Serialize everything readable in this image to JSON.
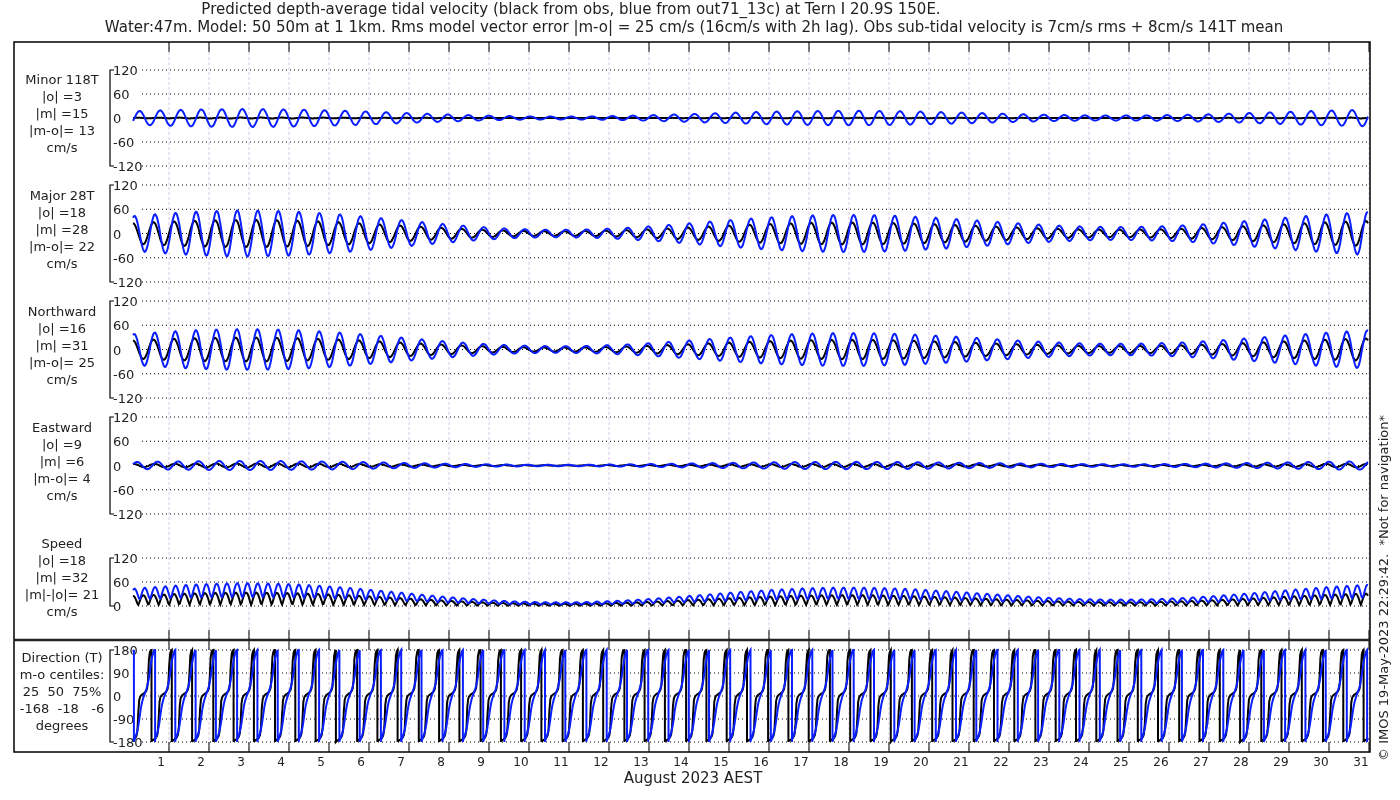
{
  "title_lines": [
    "Predicted depth-average tidal velocity (black from obs, blue from out71_13c) at Tern I 20.9S 150E.",
    "Water:47m. Model: 50 50m at 1 1km. Rms model vector error |m-o| = 25 cm/s (16cm/s with 2h lag). Obs sub-tidal velocity is 7cm/s rms + 8cm/s 141T mean"
  ],
  "panels": [
    {
      "kind": "component",
      "label_lines": [
        "Minor 118T",
        "|o| =3",
        "|m| =15",
        "|m-o|= 13",
        "cm/s"
      ],
      "yticks": [
        "120",
        "60",
        "0",
        "-60",
        "-120"
      ]
    },
    {
      "kind": "component",
      "label_lines": [
        "Major 28T",
        "|o| =18",
        "|m| =28",
        "|m-o|= 22",
        "cm/s"
      ],
      "yticks": [
        "120",
        "60",
        "0",
        "-60",
        "-120"
      ]
    },
    {
      "kind": "component",
      "label_lines": [
        "Northward",
        "|o| =16",
        "|m| =31",
        "|m-o|= 25",
        "cm/s"
      ],
      "yticks": [
        "120",
        "60",
        "0",
        "-60",
        "-120"
      ]
    },
    {
      "kind": "component",
      "label_lines": [
        "Eastward",
        "|o| =9",
        "|m| =6",
        "|m-o|= 4",
        "cm/s"
      ],
      "yticks": [
        "120",
        "60",
        "0",
        "-60",
        "-120"
      ]
    },
    {
      "kind": "speed",
      "label_lines": [
        "Speed",
        "|o| =18",
        "|m| =32",
        "|m|-|o|= 21",
        "cm/s"
      ],
      "yticks": [
        "120",
        "60",
        "0"
      ]
    },
    {
      "kind": "direction",
      "label_lines": [
        "Direction (T)",
        "m-o centiles:",
        "25  50  75%",
        "-168  -18   -6",
        "degrees"
      ],
      "yticks": [
        "180",
        "90",
        "0",
        "-90",
        "-180"
      ]
    }
  ],
  "xticks": [
    "1",
    "2",
    "3",
    "4",
    "5",
    "6",
    "7",
    "8",
    "9",
    "10",
    "11",
    "12",
    "13",
    "14",
    "15",
    "16",
    "17",
    "18",
    "19",
    "20",
    "21",
    "22",
    "23",
    "24",
    "25",
    "26",
    "27",
    "28",
    "29",
    "30",
    "31"
  ],
  "xlabel": "August 2023 AEST",
  "credit": "© IMOS 19-May-2023 22:29:42.  *Not for navigation*"
}
